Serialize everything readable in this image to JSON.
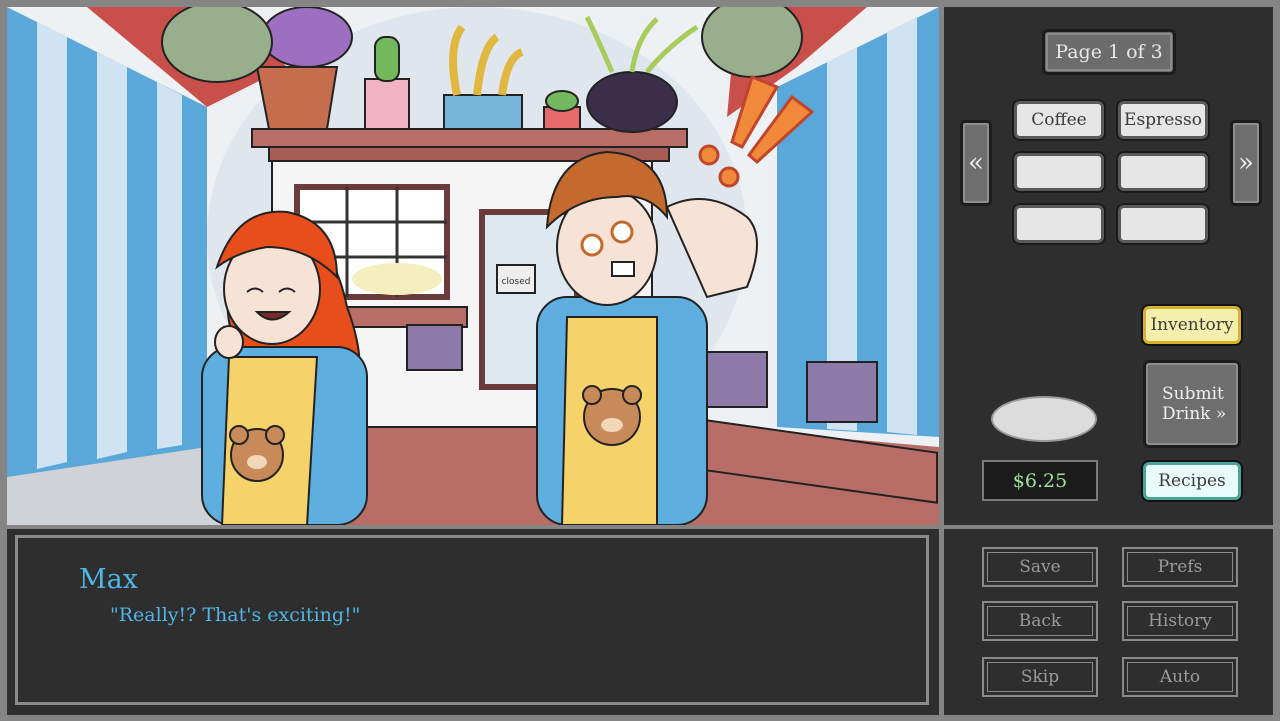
{
  "game": {
    "page_indicator": "Page 1 of 3",
    "nav": {
      "prev_label": "«",
      "next_label": "»"
    },
    "drink_slots": [
      "Coffee",
      "Espresso",
      "",
      "",
      "",
      ""
    ],
    "inventory_label": "Inventory",
    "submit": {
      "line1": "Submit",
      "line2": "Drink »"
    },
    "recipes_label": "Recipes",
    "money": "$6.25",
    "closed_sign": "closed"
  },
  "dialogue": {
    "speaker": "Max",
    "text": "\"Really!? That's exciting!\""
  },
  "menu": {
    "save": "Save",
    "prefs": "Prefs",
    "back": "Back",
    "history": "History",
    "skip": "Skip",
    "auto": "Auto"
  },
  "colors": {
    "speaker": "#4fb6e6",
    "money": "#9fe29a",
    "panel": "#2e2e2e",
    "frame": "#858585"
  }
}
